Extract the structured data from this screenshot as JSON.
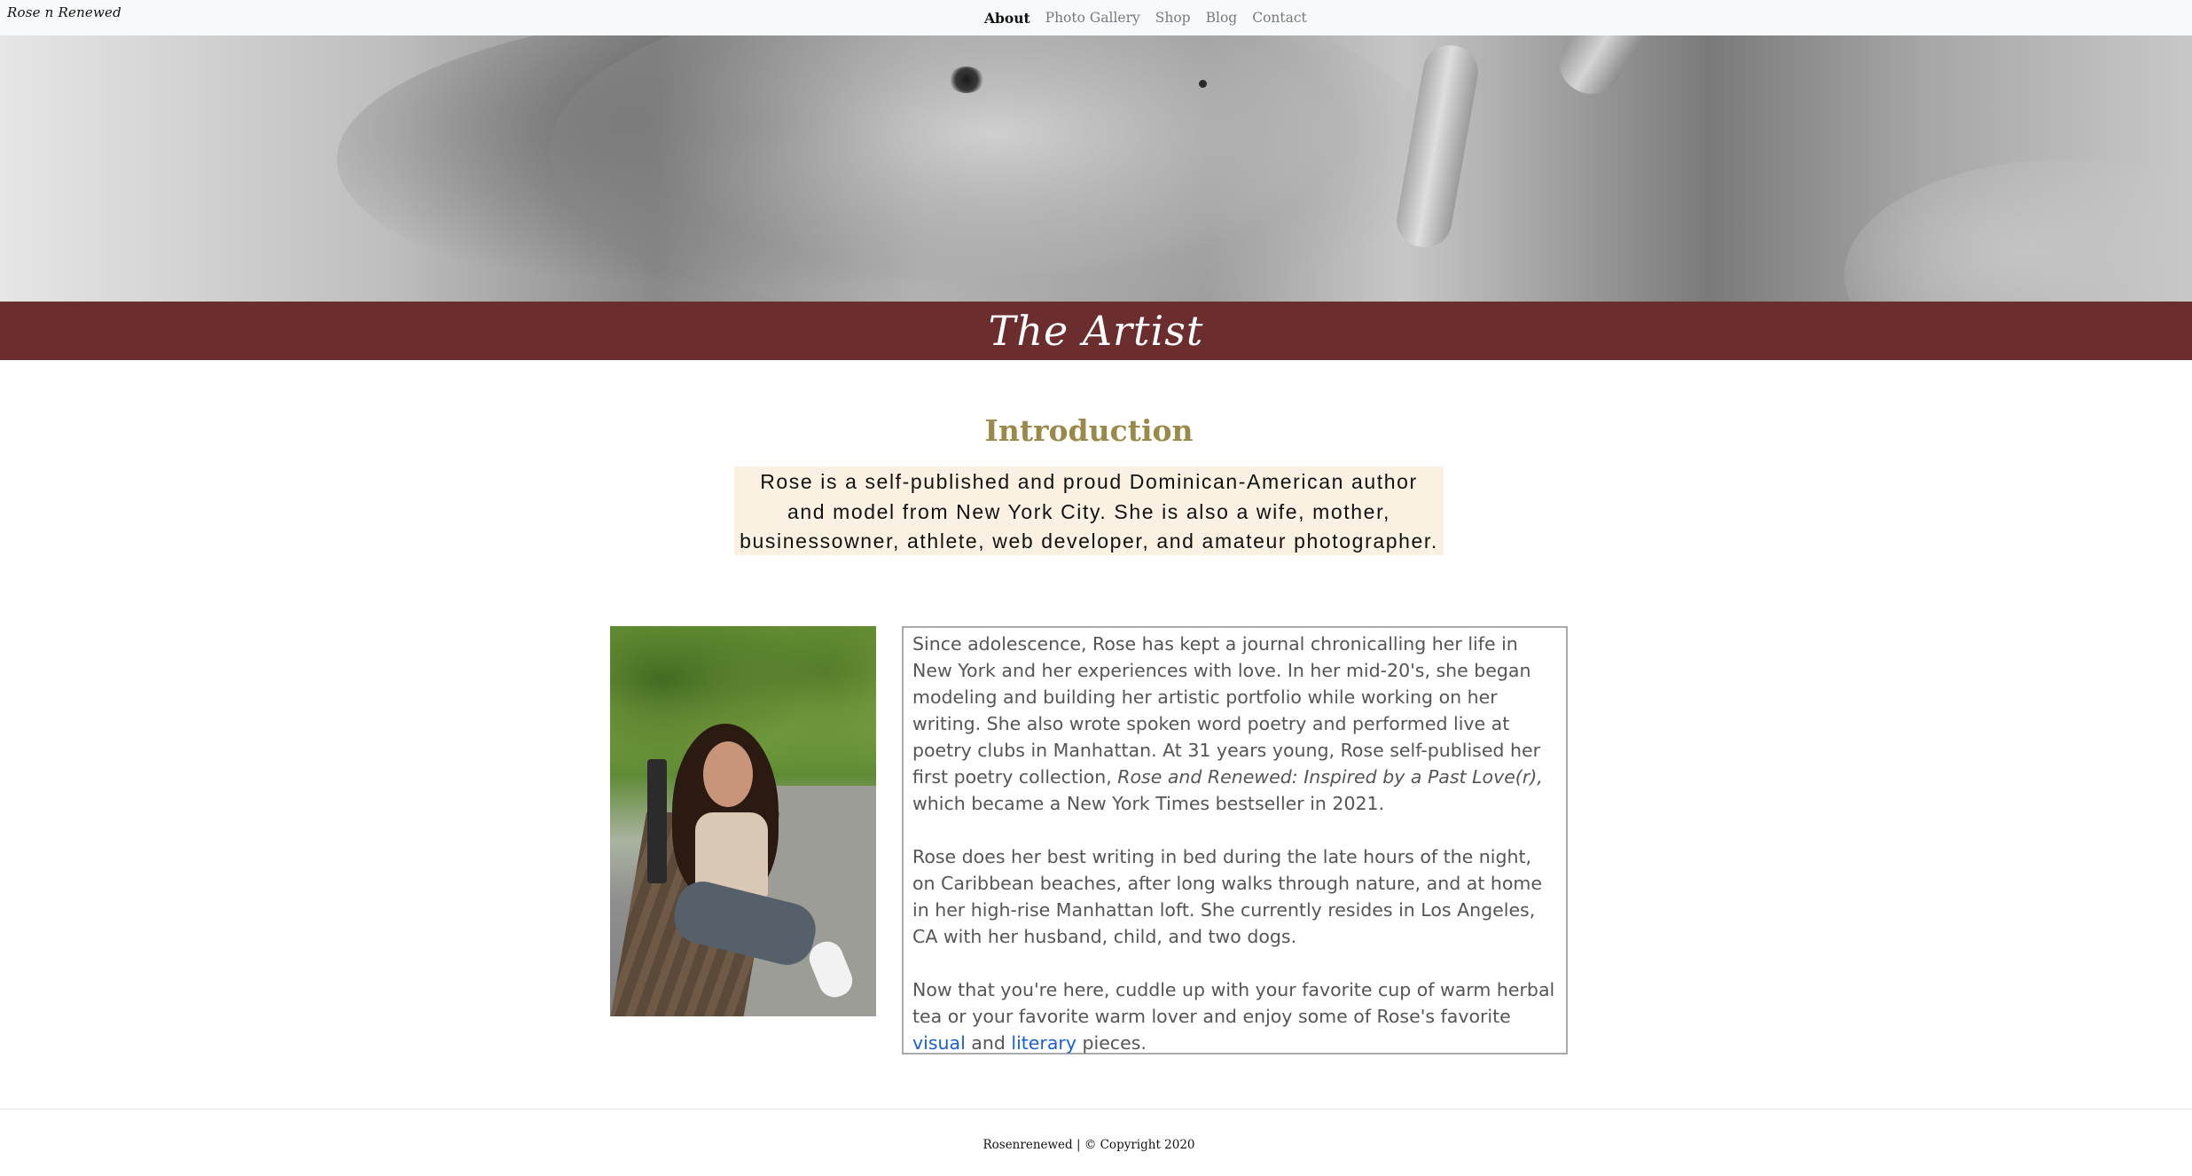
{
  "navbar": {
    "brand": "Rose n Renewed",
    "links": [
      {
        "label": "About",
        "active": true
      },
      {
        "label": "Photo Gallery",
        "active": false
      },
      {
        "label": "Shop",
        "active": false
      },
      {
        "label": "Blog",
        "active": false
      },
      {
        "label": "Contact",
        "active": false
      }
    ]
  },
  "banner": {
    "title": "The Artist",
    "color": "#6b2d2d"
  },
  "intro": {
    "heading": "Introduction",
    "heading_color": "#9a8a4a",
    "lines": [
      "Rose is a self-published and proud Dominican-American author",
      "and model from New York City. She is also a wife, mother,",
      "businessowner, athlete, web developer, and amateur photographer."
    ]
  },
  "bio": {
    "paragraph1_before": "Since adolescence, Rose has kept a journal chronicalling her life in New York and her experiences with love. In her mid-20's, she began modeling and building her artistic portfolio while working on her writing. She also wrote spoken word poetry and performed live at poetry clubs in Manhattan. At 31 years young, Rose self-publised her first poetry collection, ",
    "book_title": "Rose and Renewed: Inspired by a Past Love(r),",
    "paragraph1_after": " which became a New York Times bestseller in 2021.",
    "paragraph2": "Rose does her best writing in bed during the late hours of the night, on Caribbean beaches, after long walks through nature, and at home in her high-rise Manhattan loft. She currently resides in Los Angeles, CA with her husband, child, and two dogs.",
    "paragraph3_before": "Now that you're here, cuddle up with your favorite cup of warm herbal tea or your favorite warm lover and enjoy some of Rose's favorite ",
    "link_visual": "visual",
    "paragraph3_middle": " and ",
    "link_literary": "literary",
    "paragraph3_after": " pieces.",
    "link_color": "#1a5fd6"
  },
  "footer": {
    "text": "Rosenrenewed | © Copyright 2020"
  }
}
